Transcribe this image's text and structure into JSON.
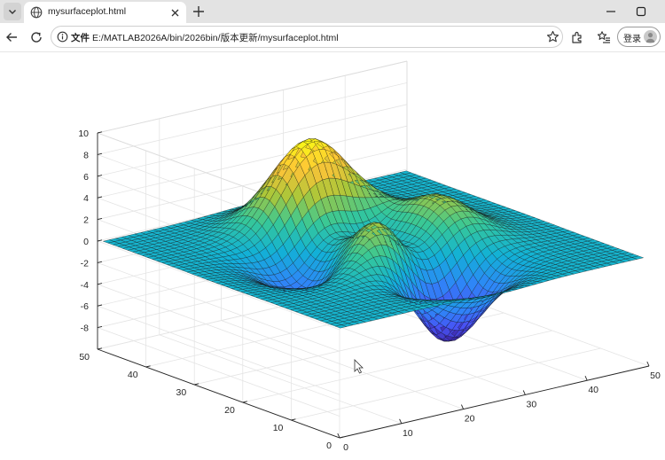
{
  "browser": {
    "tab": {
      "title": "mysurfaceplot.html",
      "favicon": "globe-icon"
    },
    "address_bar": {
      "scheme_label": "文件",
      "url": "E:/MATLAB2026A/bin/2026bin/版本更新/mysurfaceplot.html"
    },
    "sign_in_label": "登录"
  },
  "chart_data": {
    "type": "surface",
    "function": "peaks",
    "grid_size": [
      49,
      49
    ],
    "colormap": "parula",
    "z_values_note": "",
    "xlim": [
      0,
      50
    ],
    "ylim": [
      0,
      50
    ],
    "zlim": [
      -10,
      10
    ],
    "x_ticks": [
      "0",
      "10",
      "20",
      "30",
      "40",
      "50"
    ],
    "y_ticks": [
      "0",
      "10",
      "20",
      "30",
      "40",
      "50"
    ],
    "z_ticks": [
      "-8",
      "-6",
      "-4",
      "-2",
      "0",
      "2",
      "4",
      "6",
      "8",
      "10"
    ],
    "grid": true,
    "title": "",
    "xlabel": "",
    "ylabel": "",
    "zlabel": ""
  }
}
